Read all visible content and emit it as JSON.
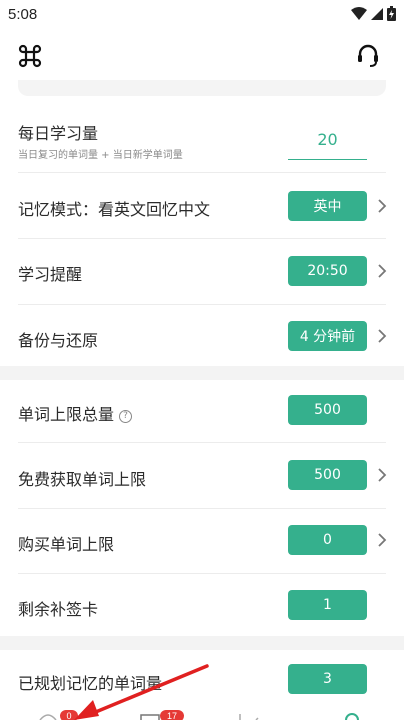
{
  "status_bar": {
    "time": "5:08",
    "icons": [
      "wifi-icon",
      "signal-icon",
      "battery-icon"
    ]
  },
  "header": {
    "left_icon": "command-icon",
    "right_icon": "headset-icon"
  },
  "settings": {
    "daily_amount": {
      "label": "每日学习量",
      "hint": "当日复习的单词量 + 当日新学单词量",
      "value": "20"
    },
    "memory_mode": {
      "label": "记忆模式：看英文回忆中文",
      "value": "英中"
    },
    "reminder": {
      "label": "学习提醒",
      "value": "20:50"
    },
    "backup": {
      "label": "备份与还原",
      "value": "4 分钟前"
    },
    "word_limit_total": {
      "label": "单词上限总量",
      "help": "?",
      "value": "500"
    },
    "free_limit": {
      "label": "免费获取单词上限",
      "value": "500"
    },
    "buy_limit": {
      "label": "购买单词上限",
      "value": "0"
    },
    "makeup_cards": {
      "label": "剩余补签卡",
      "value": "1"
    },
    "planned_words": {
      "label": "已规划记忆的单词量",
      "value": "3"
    }
  },
  "tab_bar": {
    "badges": [
      "0",
      "17"
    ]
  },
  "colors": {
    "accent": "#35b08d",
    "badge": "#e53935",
    "annotation": "#e02020"
  }
}
